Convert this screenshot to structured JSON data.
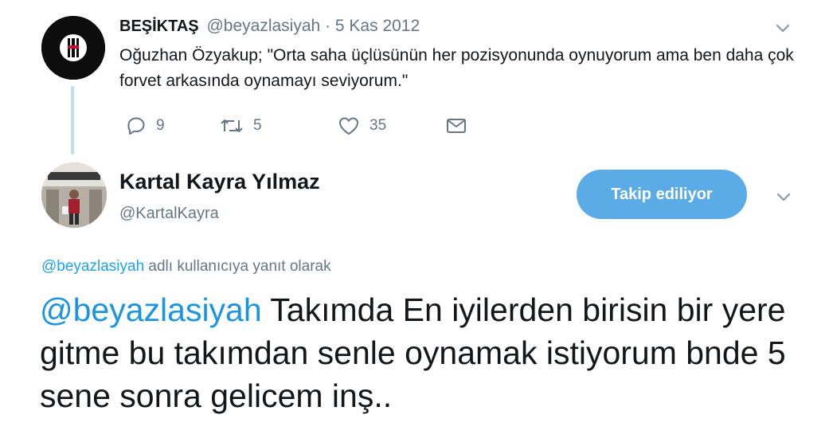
{
  "parent_tweet": {
    "name": "BEŞİKTAŞ",
    "handle": "@beyazlasiyah",
    "separator": "·",
    "date": "5 Kas 2012",
    "text": "Oğuzhan Özyakup; \"Orta saha üçlüsünün her pozisyonunda oynuyorum ama ben daha çok forvet arkasında oynamayı seviyorum.\"",
    "actions": {
      "reply_icon": "reply-icon",
      "reply_count": "9",
      "retweet_icon": "retweet-icon",
      "retweet_count": "5",
      "like_icon": "heart-icon",
      "like_count": "35",
      "dm_icon": "envelope-icon"
    }
  },
  "tweet": {
    "name": "Kartal Kayra Yılmaz",
    "handle": "@KartalKayra",
    "follow_label": "Takip ediliyor",
    "reply_context_mention": "@beyazlasiyah",
    "reply_context_text": " adlı kullanıcıya yanıt olarak",
    "text_mention": "@beyazlasiyah",
    "text": " Takımda En iyilerden birisin bir yere gitme bu takımdan senle oynamak istiyorum bnde 5 sene sonra gelicem inş.."
  },
  "colors": {
    "accent": "#1da1f2",
    "follow_button": "#5aabe6",
    "muted_text": "#657786",
    "thread_line": "#bcdff5"
  }
}
